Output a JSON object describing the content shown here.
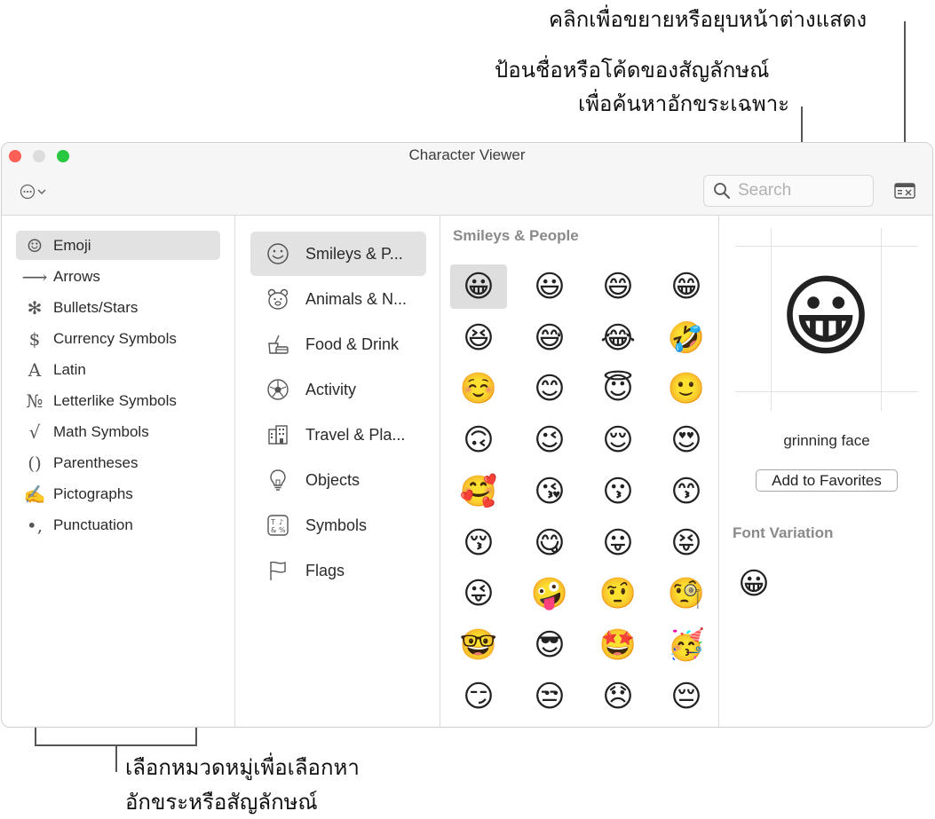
{
  "callouts": {
    "toggle": "คลิกเพื่อขยายหรือยุบหน้าต่างแสดง",
    "search_line1": "ป้อนชื่อหรือโค้ดของสัญลักษณ์",
    "search_line2": "เพื่อค้นหาอักขระเฉพาะ",
    "category_line1": "เลือกหมวดหมู่เพื่อเลือกหา",
    "category_line2": "อักขระหรือสัญลักษณ์"
  },
  "window": {
    "title": "Character Viewer",
    "search_placeholder": "Search"
  },
  "colors": {
    "close": "#ff5f57",
    "minimize": "#dcdcdc",
    "zoom": "#28c840",
    "selected_bg": "#e2e2e2"
  },
  "categories": [
    {
      "label": "Emoji",
      "icon": "smiley-icon",
      "glyph": "☺",
      "selected": true
    },
    {
      "label": "Arrows",
      "icon": "arrow-icon",
      "glyph": "⟶"
    },
    {
      "label": "Bullets/Stars",
      "icon": "asterisk-icon",
      "glyph": "✻"
    },
    {
      "label": "Currency Symbols",
      "icon": "dollar-icon",
      "glyph": "$"
    },
    {
      "label": "Latin",
      "icon": "latin-a-icon",
      "glyph": "A"
    },
    {
      "label": "Letterlike Symbols",
      "icon": "numero-icon",
      "glyph": "№"
    },
    {
      "label": "Math Symbols",
      "icon": "square-root-icon",
      "glyph": "√"
    },
    {
      "label": "Parentheses",
      "icon": "parentheses-icon",
      "glyph": "()"
    },
    {
      "label": "Pictographs",
      "icon": "pencil-icon",
      "glyph": "✍"
    },
    {
      "label": "Punctuation",
      "icon": "comma-icon",
      "glyph": "•,"
    }
  ],
  "subcategories": [
    {
      "label": "Smileys & P...",
      "icon": "smiley-outline-icon",
      "selected": true
    },
    {
      "label": "Animals & N...",
      "icon": "bear-icon"
    },
    {
      "label": "Food & Drink",
      "icon": "food-drink-icon"
    },
    {
      "label": "Activity",
      "icon": "soccer-ball-icon"
    },
    {
      "label": "Travel & Pla...",
      "icon": "building-icon"
    },
    {
      "label": "Objects",
      "icon": "lightbulb-icon"
    },
    {
      "label": "Symbols",
      "icon": "symbols-icon"
    },
    {
      "label": "Flags",
      "icon": "flag-icon"
    }
  ],
  "grid": {
    "title": "Smileys & People",
    "emojis": [
      "😀",
      "😃",
      "😄",
      "😁",
      "😆",
      "😅",
      "😂",
      "🤣",
      "☺️",
      "😊",
      "😇",
      "🙂",
      "🙃",
      "😉",
      "😌",
      "😍",
      "🥰",
      "😘",
      "😗",
      "😙",
      "😚",
      "😋",
      "😛",
      "😝",
      "😜",
      "🤪",
      "🤨",
      "🧐",
      "🤓",
      "😎",
      "🤩",
      "🥳",
      "😏",
      "😒",
      "😞",
      "😔"
    ]
  },
  "detail": {
    "preview": "😀",
    "name": "grinning face",
    "favorites_button": "Add to Favorites",
    "font_variation_title": "Font Variation",
    "font_variation_item": "😀"
  }
}
